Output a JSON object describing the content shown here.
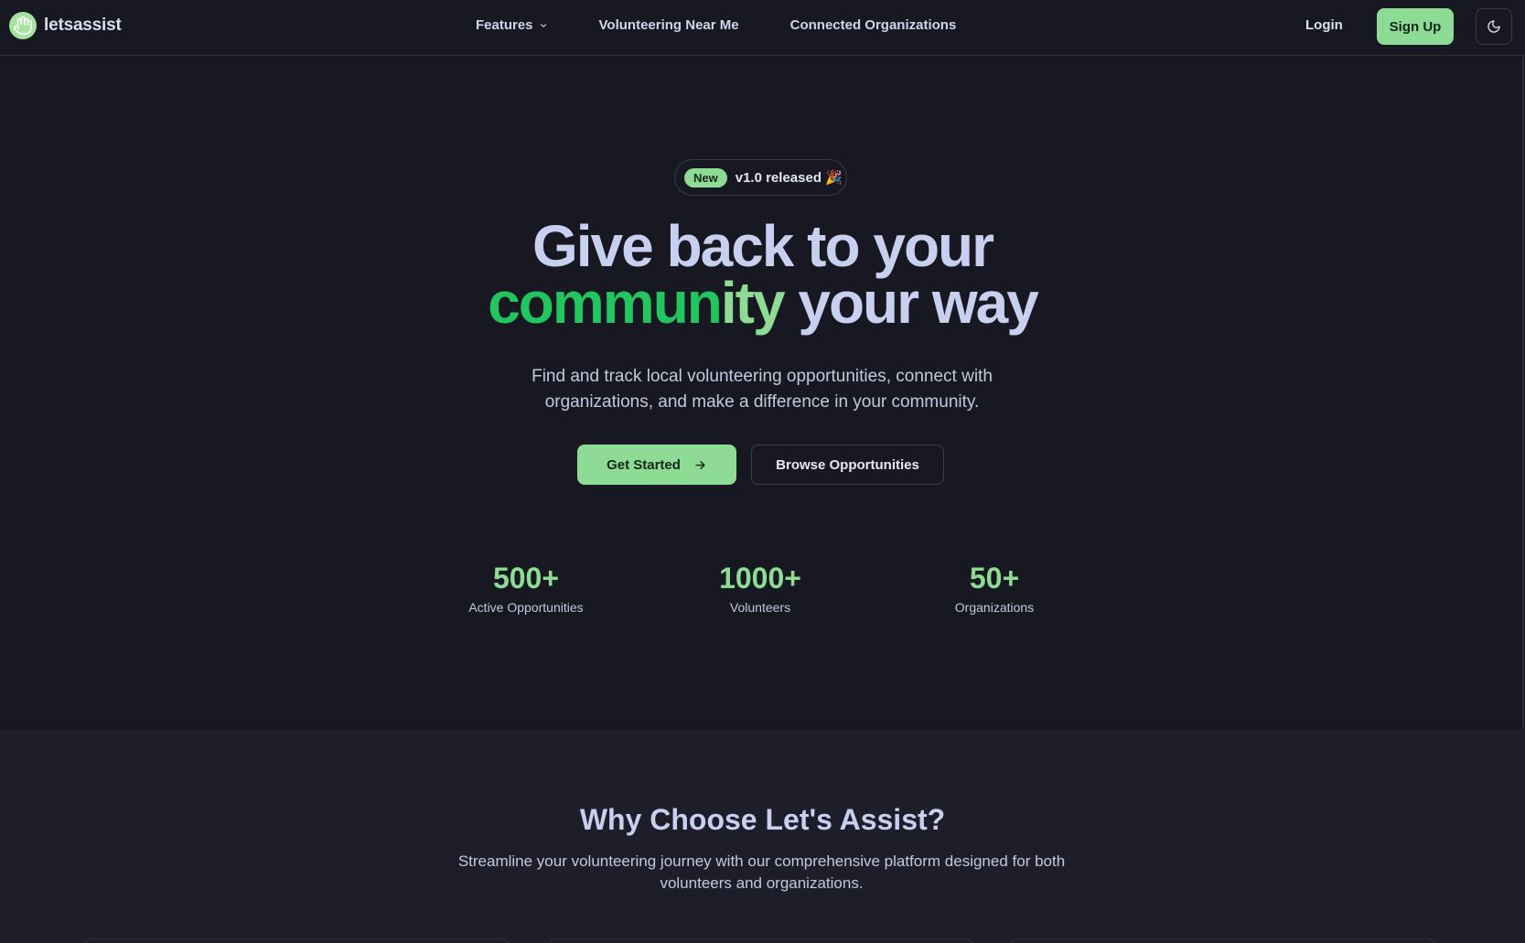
{
  "nav": {
    "brand": "letsassist",
    "links": {
      "features": "Features",
      "near_me": "Volunteering Near Me",
      "orgs": "Connected Organizations"
    },
    "login": "Login",
    "signup": "Sign Up"
  },
  "hero": {
    "badge_new": "New",
    "badge_text": "v1.0 released 🎉",
    "title_line1": "Give back to your",
    "title_green_a": "commun",
    "title_green_b": "ity",
    "title_line2_rest": " your way",
    "subtitle": "Find and track local volunteering opportunities, connect with organizations, and make a difference in your community.",
    "cta_primary": "Get Started",
    "cta_secondary": "Browse Opportunities"
  },
  "stats": [
    {
      "value": "500+",
      "label": "Active Opportunities"
    },
    {
      "value": "1000+",
      "label": "Volunteers"
    },
    {
      "value": "50+",
      "label": "Organizations"
    }
  ],
  "why": {
    "title": "Why Choose Let's Assist?",
    "subtitle": "Streamline your volunteering journey with our comprehensive platform designed for both volunteers and organizations."
  },
  "colors": {
    "background": "#171821",
    "accent": "#8ddb95",
    "accent_strong": "#22c55e",
    "heading": "#c8d0ef"
  },
  "icons": [
    "hand-logo-icon",
    "chevron-down-icon",
    "arrow-right-icon",
    "moon-icon"
  ]
}
